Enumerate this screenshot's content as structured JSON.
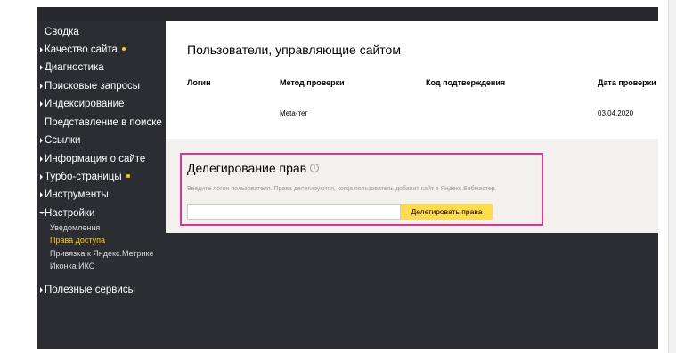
{
  "sidebar": {
    "items": [
      {
        "label": "Сводка",
        "arrow": "none",
        "dot": false
      },
      {
        "label": "Качество сайта",
        "arrow": "right",
        "dot": true
      },
      {
        "label": "Диагностика",
        "arrow": "right",
        "dot": false
      },
      {
        "label": "Поисковые запросы",
        "arrow": "right",
        "dot": false
      },
      {
        "label": "Индексирование",
        "arrow": "right",
        "dot": false
      },
      {
        "label": "Представление в поиске",
        "arrow": "none",
        "dot": false
      },
      {
        "label": "Ссылки",
        "arrow": "right",
        "dot": false
      },
      {
        "label": "Информация о сайте",
        "arrow": "right",
        "dot": false
      },
      {
        "label": "Турбо-страницы",
        "arrow": "right",
        "dot": true
      },
      {
        "label": "Инструменты",
        "arrow": "right",
        "dot": false
      },
      {
        "label": "Настройки",
        "arrow": "down",
        "dot": false
      },
      {
        "label": "Полезные сервисы",
        "arrow": "right",
        "dot": false
      }
    ],
    "settings_subitems": [
      {
        "label": "Уведомления",
        "active": false
      },
      {
        "label": "Права доступа",
        "active": true
      },
      {
        "label": "Привязка к Яндекс.Метрике",
        "active": false
      },
      {
        "label": "Иконка ИКС",
        "active": false
      }
    ]
  },
  "users": {
    "title": "Пользователи, управляющие сайтом",
    "columns": [
      "Логин",
      "Метод проверки",
      "Код подтверждения",
      "Дата проверки"
    ],
    "rows": [
      [
        "",
        "Meta-тег",
        "",
        "03.04.2020"
      ]
    ]
  },
  "delegation": {
    "title": "Делегирование прав",
    "info_icon": "info-icon",
    "hint": "Введите логин пользователя. Права делегируются, когда пользователь добавит сайт в Яндекс.Вебмастер.",
    "input_value": "",
    "input_placeholder": "",
    "button_label": "Делегировать права"
  },
  "colors": {
    "sidebar_bg": "#2b2d33",
    "accent_yellow": "#ffcc00",
    "button_yellow": "#ffdb4d",
    "highlight_border": "#e0358f",
    "panel_bg": "#f3f1ed"
  }
}
